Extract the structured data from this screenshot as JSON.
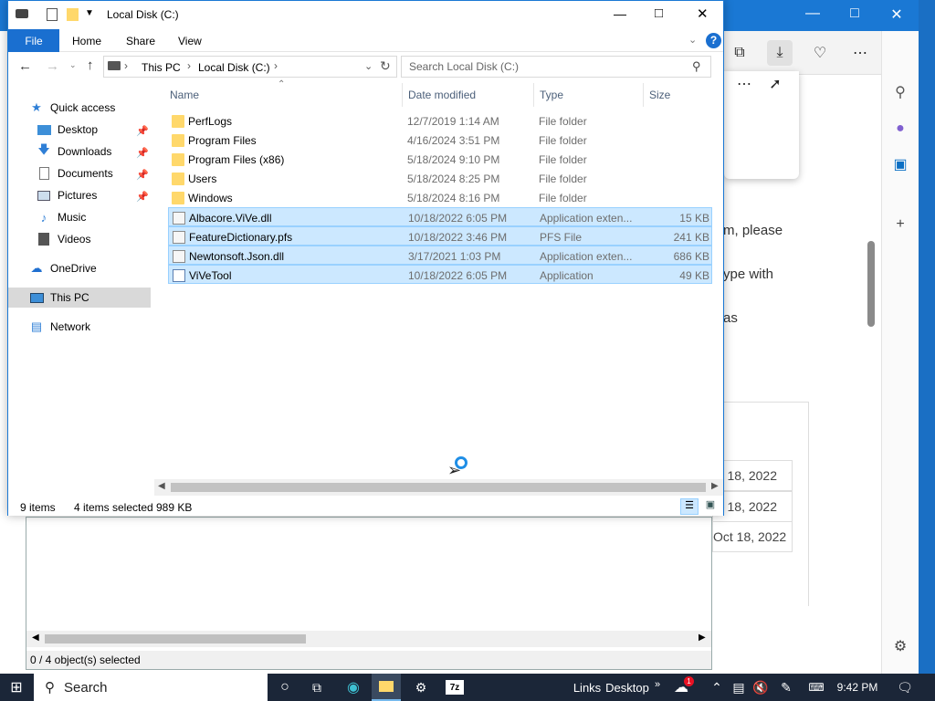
{
  "background_window": {
    "text_lines": [
      "m, please",
      "ype with",
      "as"
    ],
    "dates": [
      "t 18, 2022",
      "t 18, 2022",
      "Oct 18, 2022"
    ]
  },
  "explorer": {
    "title": "Local Disk (C:)",
    "ribbon_tabs": [
      "File",
      "Home",
      "Share",
      "View"
    ],
    "breadcrumb": [
      "This PC",
      "Local Disk (C:)"
    ],
    "search_placeholder": "Search Local Disk (C:)",
    "columns": {
      "name": "Name",
      "date": "Date modified",
      "type": "Type",
      "size": "Size"
    },
    "nav": [
      {
        "label": "Quick access",
        "icon": "star-icon"
      },
      {
        "label": "Desktop",
        "icon": "desktop-icon",
        "pinned": true
      },
      {
        "label": "Downloads",
        "icon": "download-icon",
        "pinned": true
      },
      {
        "label": "Documents",
        "icon": "document-icon",
        "pinned": true
      },
      {
        "label": "Pictures",
        "icon": "picture-icon",
        "pinned": true
      },
      {
        "label": "Music",
        "icon": "music-icon"
      },
      {
        "label": "Videos",
        "icon": "video-icon"
      },
      {
        "label": "OneDrive",
        "icon": "cloud-icon"
      },
      {
        "label": "This PC",
        "icon": "computer-icon",
        "selected": true
      },
      {
        "label": "Network",
        "icon": "network-icon"
      }
    ],
    "files": [
      {
        "name": "PerfLogs",
        "date": "12/7/2019 1:14 AM",
        "type": "File folder",
        "size": "",
        "kind": "folder",
        "selected": false
      },
      {
        "name": "Program Files",
        "date": "4/16/2024 3:51 PM",
        "type": "File folder",
        "size": "",
        "kind": "folder",
        "selected": false
      },
      {
        "name": "Program Files (x86)",
        "date": "5/18/2024 9:10 PM",
        "type": "File folder",
        "size": "",
        "kind": "folder",
        "selected": false
      },
      {
        "name": "Users",
        "date": "5/18/2024 8:25 PM",
        "type": "File folder",
        "size": "",
        "kind": "folder",
        "selected": false
      },
      {
        "name": "Windows",
        "date": "5/18/2024 8:16 PM",
        "type": "File folder",
        "size": "",
        "kind": "folder",
        "selected": false
      },
      {
        "name": "Albacore.ViVe.dll",
        "date": "10/18/2022 6:05 PM",
        "type": "Application exten...",
        "size": "15 KB",
        "kind": "dll",
        "selected": true
      },
      {
        "name": "FeatureDictionary.pfs",
        "date": "10/18/2022 3:46 PM",
        "type": "PFS File",
        "size": "241 KB",
        "kind": "file",
        "selected": true
      },
      {
        "name": "Newtonsoft.Json.dll",
        "date": "3/17/2021 1:03 PM",
        "type": "Application exten...",
        "size": "686 KB",
        "kind": "dll",
        "selected": true
      },
      {
        "name": "ViVeTool",
        "date": "10/18/2022 6:05 PM",
        "type": "Application",
        "size": "49 KB",
        "kind": "app",
        "selected": true
      }
    ],
    "status": {
      "items": "9 items",
      "selected": "4 items selected",
      "size": "989 KB"
    }
  },
  "second_window": {
    "status": "0 / 4 object(s) selected"
  },
  "taskbar": {
    "search": "Search",
    "links": "Links",
    "desktop": "Desktop",
    "notification_count": "1",
    "clock": "9:42 PM"
  }
}
